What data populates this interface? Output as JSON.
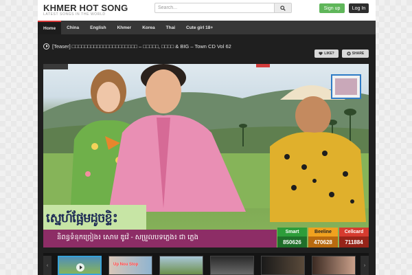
{
  "header": {
    "logo_title": "KHMER HOT SONG",
    "logo_tagline": "LATEST SONGS IN THE WORLD",
    "search_placeholder": "Search...",
    "signup_label": "Sign up",
    "login_label": "Log In"
  },
  "nav": {
    "items": [
      {
        "label": "Home",
        "active": true
      },
      {
        "label": "China"
      },
      {
        "label": "English"
      },
      {
        "label": "Khmer"
      },
      {
        "label": "Korea"
      },
      {
        "label": "Thai"
      },
      {
        "label": "Cute girl 18+"
      }
    ]
  },
  "video": {
    "title": "[Teaser] □□□□□□□□□□□□□□□□□□□□□ – □□□□□, □□□□ & BIG – Town CD Vol 62",
    "like_label": "LIKE?",
    "share_label": "SHARE",
    "sign_title": "ស្នេហ៍ផ្អែមដូចខ្ទិះ",
    "sign_credits": "និពន្ធទំនុកច្រៀង៖ សោម ឌូវ៉េ - សម្រួលបទភ្លេង៖ ជា ភ្លេង",
    "codes": [
      {
        "name": "Smart",
        "number": "850626",
        "color": "#2d9d3a"
      },
      {
        "name": "Beeline",
        "number": "470628",
        "color": "#e38a1f"
      },
      {
        "name": "Cellcard",
        "number": "711884",
        "color": "#d63b2f"
      }
    ]
  },
  "thumbnails": {
    "prev_label": "‹",
    "next_label": "›",
    "items": [
      {
        "text": "",
        "active": true
      },
      {
        "text": "Up Nou Stop"
      },
      {
        "text": ""
      },
      {
        "text": ""
      },
      {
        "text": ""
      },
      {
        "text": ""
      }
    ]
  },
  "colors": {
    "signup": "#5fb65a",
    "login": "#2e2e2e",
    "nav_active_accent": "#d93636",
    "thumb_active_border": "#38a2d9"
  }
}
